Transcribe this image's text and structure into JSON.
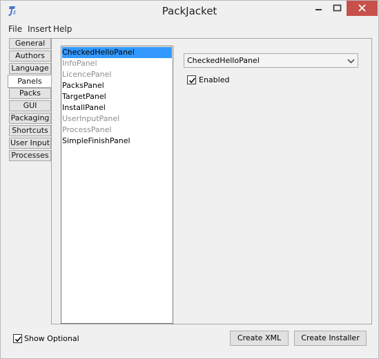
{
  "window": {
    "title": "PackJacket"
  },
  "menu": {
    "items": [
      "File",
      "Insert",
      "Help"
    ]
  },
  "tabs": [
    "General",
    "Authors",
    "Language",
    "Panels",
    "Packs",
    "GUI",
    "Packaging",
    "Shortcuts",
    "User Input",
    "Processes"
  ],
  "active_tab": "Panels",
  "panels_list": [
    {
      "label": "CheckedHelloPanel",
      "state": "selected"
    },
    {
      "label": "InfoPanel",
      "state": "disabled"
    },
    {
      "label": "LicencePanel",
      "state": "disabled"
    },
    {
      "label": "PacksPanel",
      "state": "enabled"
    },
    {
      "label": "TargetPanel",
      "state": "enabled"
    },
    {
      "label": "InstallPanel",
      "state": "enabled"
    },
    {
      "label": "UserInputPanel",
      "state": "disabled"
    },
    {
      "label": "ProcessPanel",
      "state": "disabled"
    },
    {
      "label": "SimpleFinishPanel",
      "state": "enabled"
    }
  ],
  "panel_select": {
    "value": "CheckedHelloPanel"
  },
  "enabled_checkbox": {
    "label": "Enabled",
    "checked": true
  },
  "show_optional": {
    "label": "Show Optional",
    "checked": true
  },
  "buttons": {
    "create_xml": "Create XML",
    "create_installer": "Create Installer"
  },
  "colors": {
    "selection": "#3399ff",
    "close_button": "#c7504b",
    "disabled_text": "#8c8c8c"
  },
  "icons": {
    "app": "packjacket-icon",
    "minimize": "minimize-icon",
    "maximize": "maximize-icon",
    "close": "close-icon",
    "dropdown": "chevron-down-icon",
    "check": "checkmark-icon"
  }
}
